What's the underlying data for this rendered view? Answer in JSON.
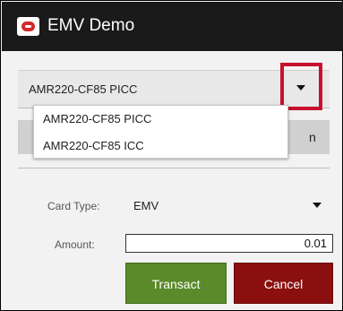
{
  "app": {
    "title": "EMV Demo",
    "icon": "reader-app-icon"
  },
  "reader_spinner": {
    "selected": "AMR220-CF85 PICC",
    "highlight_color": "#c8102e",
    "options": [
      "AMR220-CF85 PICC",
      "AMR220-CF85 ICC"
    ]
  },
  "hidden_button": {
    "partial_label": "n"
  },
  "card_type": {
    "label": "Card Type:",
    "selected": "EMV"
  },
  "amount": {
    "label": "Amount:",
    "value": "0.01"
  },
  "buttons": {
    "transact": {
      "label": "Transact",
      "color": "#5a8a2a"
    },
    "cancel": {
      "label": "Cancel",
      "color": "#8b0f0f"
    }
  }
}
